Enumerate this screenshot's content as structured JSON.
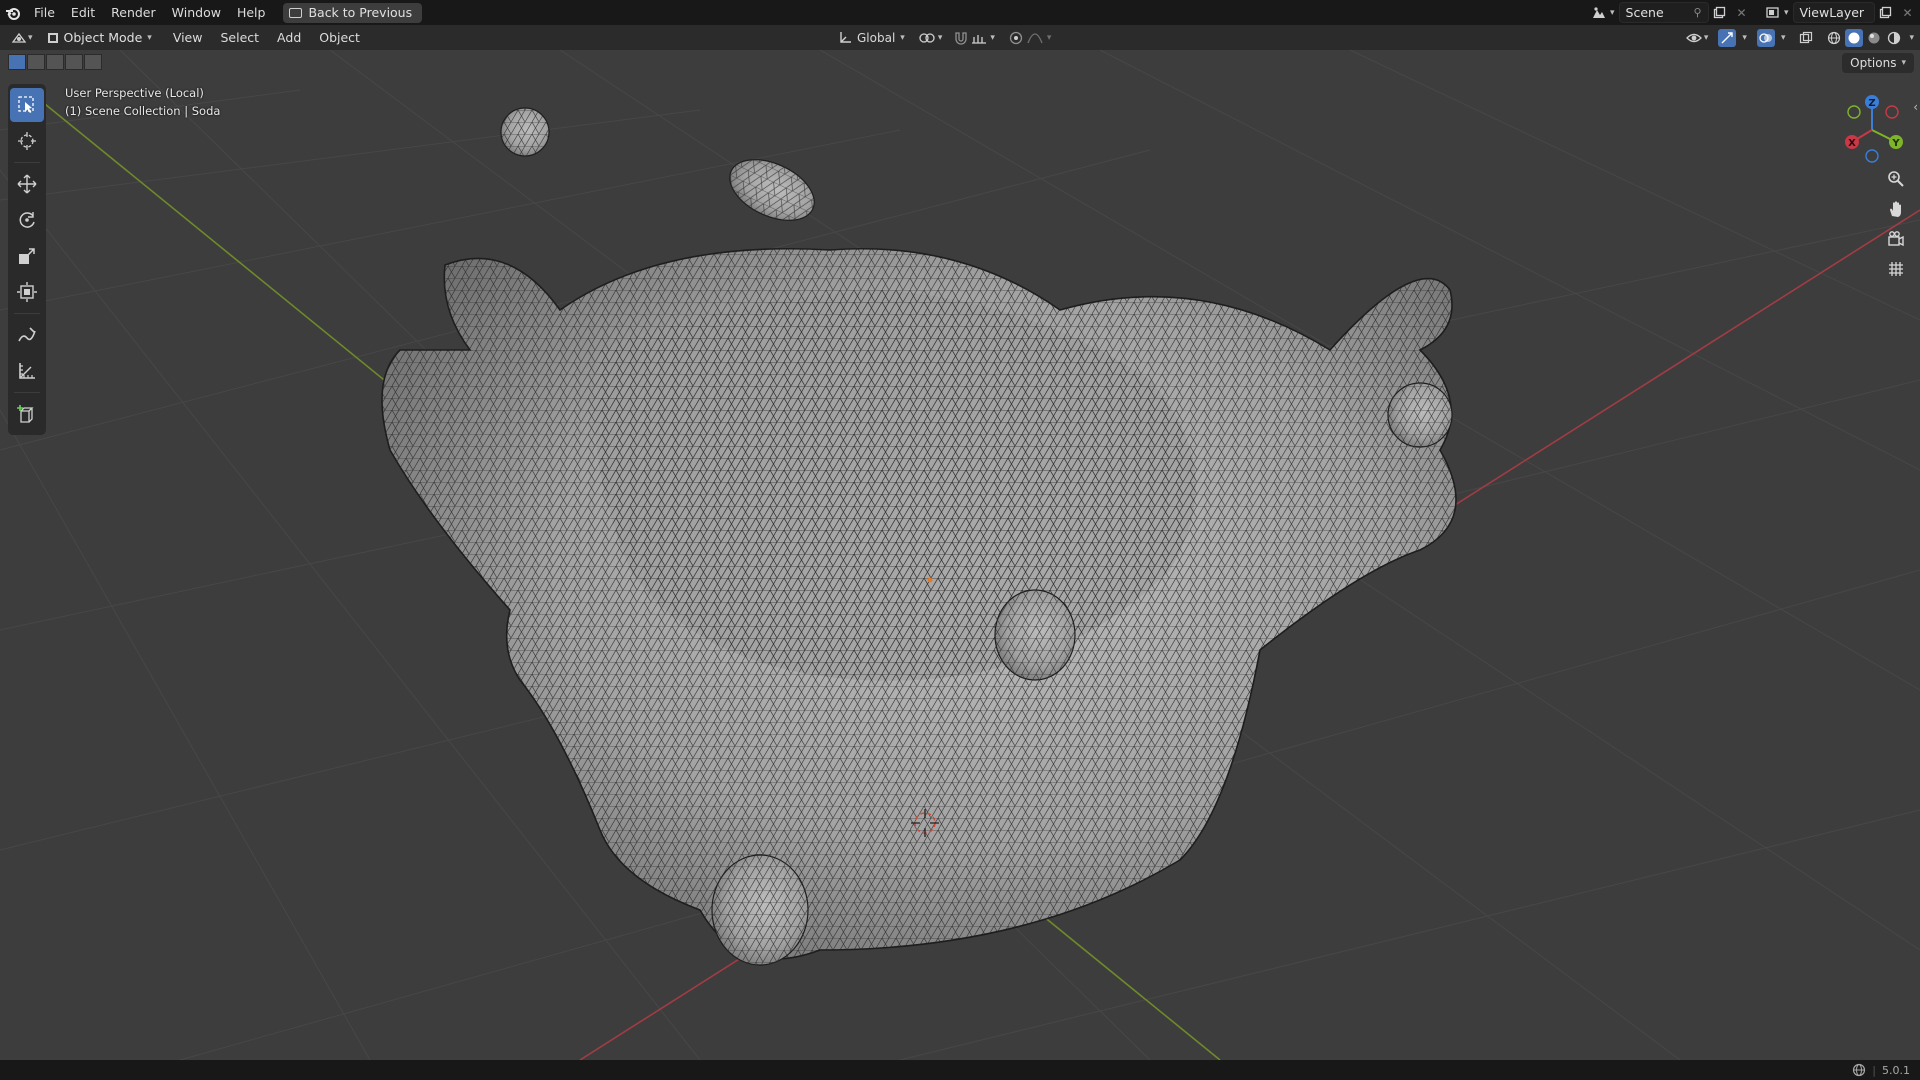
{
  "topbar": {
    "menus": [
      "File",
      "Edit",
      "Render",
      "Window",
      "Help"
    ],
    "back_button": "Back to Previous",
    "scene_name": "Scene",
    "view_layer": "ViewLayer"
  },
  "header": {
    "mode": "Object Mode",
    "menus": [
      "View",
      "Select",
      "Add",
      "Object"
    ],
    "transform_orientation": "Global"
  },
  "viewport": {
    "perspective_label": "User Perspective (Local)",
    "collection_label": "(1) Scene Collection | Soda",
    "options_label": "Options",
    "gizmo_axes": {
      "x": "X",
      "y": "Y",
      "z": "Z"
    }
  },
  "toolbar": {
    "tools": [
      "select-box-tool",
      "cursor-tool",
      "move-tool",
      "rotate-tool",
      "scale-tool",
      "transform-tool",
      "annotate-tool",
      "measure-tool",
      "add-cube-tool"
    ],
    "active": "select-box-tool"
  },
  "statusbar": {
    "version": "5.0.1"
  },
  "colors": {
    "accent": "#4772b3",
    "x_axis": "#c93846",
    "y_axis": "#7eb42a",
    "z_axis": "#3a7ed8",
    "grid": "#4a4a4a",
    "viewport_bg": "#3d3d3d"
  }
}
